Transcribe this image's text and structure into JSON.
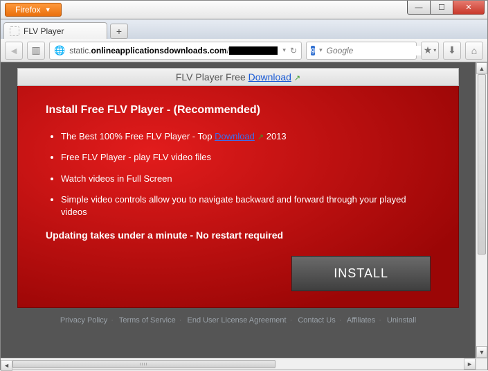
{
  "window": {
    "app_button": "Firefox",
    "tab_title": "FLV Player",
    "new_tab_tooltip": "+"
  },
  "nav": {
    "url_prefix": "static.",
    "url_bold": "onlineapplicationsdownloads.com",
    "url_suffix": "/",
    "search_engine_letter": "g",
    "search_placeholder": "Google"
  },
  "page": {
    "top_banner_text": "FLV Player Free ",
    "top_banner_link": "Download",
    "heading": "Install Free FLV Player - (Recommended)",
    "bullet1_pre": "The Best 100% Free FLV Player - Top ",
    "bullet1_link": "Download",
    "bullet1_post": " 2013",
    "bullet2": "Free FLV Player - play FLV video files",
    "bullet3": "Watch videos in Full Screen",
    "bullet4": "Simple video controls allow you to navigate backward and forward through your played videos",
    "subline": "Updating takes under a minute - No restart required",
    "install_label": "INSTALL"
  },
  "footer": {
    "links": [
      "Privacy Policy",
      "Terms of Service",
      "End User License Agreement",
      "Contact Us",
      "Affiliates",
      "Uninstall"
    ]
  }
}
